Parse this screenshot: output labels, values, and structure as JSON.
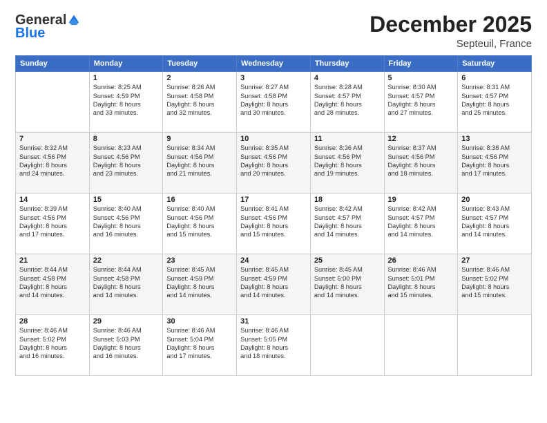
{
  "logo": {
    "general": "General",
    "blue": "Blue"
  },
  "header": {
    "month": "December 2025",
    "location": "Septeuil, France"
  },
  "days": [
    "Sunday",
    "Monday",
    "Tuesday",
    "Wednesday",
    "Thursday",
    "Friday",
    "Saturday"
  ],
  "weeks": [
    [
      {
        "day": "",
        "info": ""
      },
      {
        "day": "1",
        "info": "Sunrise: 8:25 AM\nSunset: 4:59 PM\nDaylight: 8 hours\nand 33 minutes."
      },
      {
        "day": "2",
        "info": "Sunrise: 8:26 AM\nSunset: 4:58 PM\nDaylight: 8 hours\nand 32 minutes."
      },
      {
        "day": "3",
        "info": "Sunrise: 8:27 AM\nSunset: 4:58 PM\nDaylight: 8 hours\nand 30 minutes."
      },
      {
        "day": "4",
        "info": "Sunrise: 8:28 AM\nSunset: 4:57 PM\nDaylight: 8 hours\nand 28 minutes."
      },
      {
        "day": "5",
        "info": "Sunrise: 8:30 AM\nSunset: 4:57 PM\nDaylight: 8 hours\nand 27 minutes."
      },
      {
        "day": "6",
        "info": "Sunrise: 8:31 AM\nSunset: 4:57 PM\nDaylight: 8 hours\nand 25 minutes."
      }
    ],
    [
      {
        "day": "7",
        "info": "Sunrise: 8:32 AM\nSunset: 4:56 PM\nDaylight: 8 hours\nand 24 minutes."
      },
      {
        "day": "8",
        "info": "Sunrise: 8:33 AM\nSunset: 4:56 PM\nDaylight: 8 hours\nand 23 minutes."
      },
      {
        "day": "9",
        "info": "Sunrise: 8:34 AM\nSunset: 4:56 PM\nDaylight: 8 hours\nand 21 minutes."
      },
      {
        "day": "10",
        "info": "Sunrise: 8:35 AM\nSunset: 4:56 PM\nDaylight: 8 hours\nand 20 minutes."
      },
      {
        "day": "11",
        "info": "Sunrise: 8:36 AM\nSunset: 4:56 PM\nDaylight: 8 hours\nand 19 minutes."
      },
      {
        "day": "12",
        "info": "Sunrise: 8:37 AM\nSunset: 4:56 PM\nDaylight: 8 hours\nand 18 minutes."
      },
      {
        "day": "13",
        "info": "Sunrise: 8:38 AM\nSunset: 4:56 PM\nDaylight: 8 hours\nand 17 minutes."
      }
    ],
    [
      {
        "day": "14",
        "info": "Sunrise: 8:39 AM\nSunset: 4:56 PM\nDaylight: 8 hours\nand 17 minutes."
      },
      {
        "day": "15",
        "info": "Sunrise: 8:40 AM\nSunset: 4:56 PM\nDaylight: 8 hours\nand 16 minutes."
      },
      {
        "day": "16",
        "info": "Sunrise: 8:40 AM\nSunset: 4:56 PM\nDaylight: 8 hours\nand 15 minutes."
      },
      {
        "day": "17",
        "info": "Sunrise: 8:41 AM\nSunset: 4:56 PM\nDaylight: 8 hours\nand 15 minutes."
      },
      {
        "day": "18",
        "info": "Sunrise: 8:42 AM\nSunset: 4:57 PM\nDaylight: 8 hours\nand 14 minutes."
      },
      {
        "day": "19",
        "info": "Sunrise: 8:42 AM\nSunset: 4:57 PM\nDaylight: 8 hours\nand 14 minutes."
      },
      {
        "day": "20",
        "info": "Sunrise: 8:43 AM\nSunset: 4:57 PM\nDaylight: 8 hours\nand 14 minutes."
      }
    ],
    [
      {
        "day": "21",
        "info": "Sunrise: 8:44 AM\nSunset: 4:58 PM\nDaylight: 8 hours\nand 14 minutes."
      },
      {
        "day": "22",
        "info": "Sunrise: 8:44 AM\nSunset: 4:58 PM\nDaylight: 8 hours\nand 14 minutes."
      },
      {
        "day": "23",
        "info": "Sunrise: 8:45 AM\nSunset: 4:59 PM\nDaylight: 8 hours\nand 14 minutes."
      },
      {
        "day": "24",
        "info": "Sunrise: 8:45 AM\nSunset: 4:59 PM\nDaylight: 8 hours\nand 14 minutes."
      },
      {
        "day": "25",
        "info": "Sunrise: 8:45 AM\nSunset: 5:00 PM\nDaylight: 8 hours\nand 14 minutes."
      },
      {
        "day": "26",
        "info": "Sunrise: 8:46 AM\nSunset: 5:01 PM\nDaylight: 8 hours\nand 15 minutes."
      },
      {
        "day": "27",
        "info": "Sunrise: 8:46 AM\nSunset: 5:02 PM\nDaylight: 8 hours\nand 15 minutes."
      }
    ],
    [
      {
        "day": "28",
        "info": "Sunrise: 8:46 AM\nSunset: 5:02 PM\nDaylight: 8 hours\nand 16 minutes."
      },
      {
        "day": "29",
        "info": "Sunrise: 8:46 AM\nSunset: 5:03 PM\nDaylight: 8 hours\nand 16 minutes."
      },
      {
        "day": "30",
        "info": "Sunrise: 8:46 AM\nSunset: 5:04 PM\nDaylight: 8 hours\nand 17 minutes."
      },
      {
        "day": "31",
        "info": "Sunrise: 8:46 AM\nSunset: 5:05 PM\nDaylight: 8 hours\nand 18 minutes."
      },
      {
        "day": "",
        "info": ""
      },
      {
        "day": "",
        "info": ""
      },
      {
        "day": "",
        "info": ""
      }
    ]
  ]
}
